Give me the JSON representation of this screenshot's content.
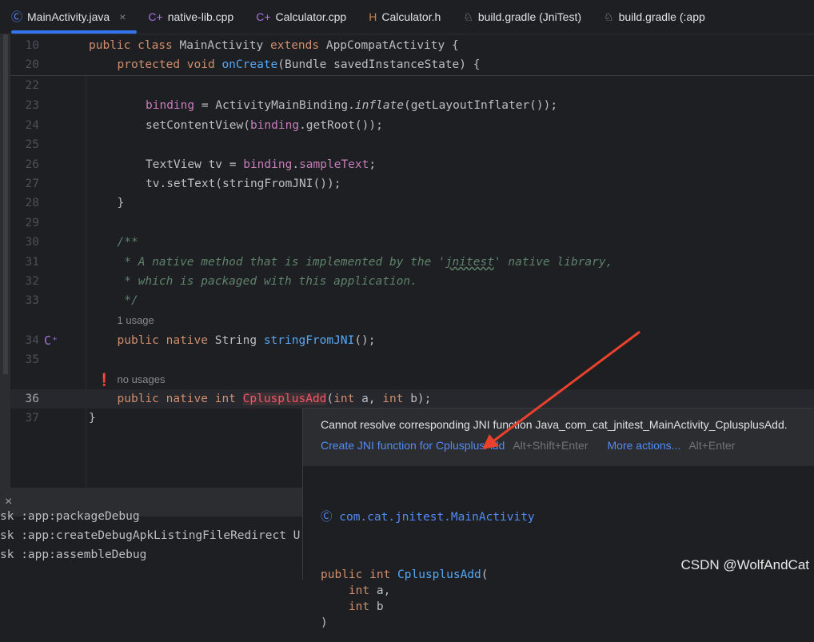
{
  "tabs": [
    {
      "label": "MainActivity.java",
      "icon": "class-icon",
      "glyph": "Ⓒ",
      "color": "#548af7",
      "active": true,
      "close": "×"
    },
    {
      "label": "native-lib.cpp",
      "icon": "cpp-icon",
      "glyph": "C+",
      "color": "#a571e6"
    },
    {
      "label": "Calculator.cpp",
      "icon": "cpp-icon",
      "glyph": "C+",
      "color": "#a571e6"
    },
    {
      "label": "Calculator.h",
      "icon": "header-icon",
      "glyph": "H",
      "color": "#c8834d"
    },
    {
      "label": "build.gradle (JniTest)",
      "icon": "gradle-icon",
      "glyph": "♘",
      "color": "#a8adb5"
    },
    {
      "label": "build.gradle (:app",
      "icon": "gradle-icon",
      "glyph": "♘",
      "color": "#a8adb5"
    }
  ],
  "code_lines": [
    {
      "num": "10",
      "indent": 0,
      "tokens": [
        [
          "public class ",
          "kw"
        ],
        [
          "MainActivity ",
          ""
        ],
        [
          "extends ",
          "kw"
        ],
        [
          "AppCompatActivity {",
          ""
        ]
      ]
    },
    {
      "num": "20",
      "indent": 1,
      "tokens": [
        [
          "protected void ",
          "kw"
        ],
        [
          "onCreate",
          "fn"
        ],
        [
          "(Bundle savedInstanceState) {",
          ""
        ]
      ]
    },
    {
      "num": "22",
      "indent": 0,
      "tokens": []
    },
    {
      "num": "23",
      "indent": 2,
      "tokens": [
        [
          "binding",
          "fld"
        ],
        [
          " = ActivityMainBinding.",
          ""
        ],
        [
          "inflate",
          "it"
        ],
        [
          "(getLayoutInflater());",
          ""
        ]
      ]
    },
    {
      "num": "24",
      "indent": 2,
      "tokens": [
        [
          "setContentView(",
          ""
        ],
        [
          "binding",
          "fld"
        ],
        [
          ".getRoot());",
          ""
        ]
      ]
    },
    {
      "num": "25",
      "indent": 0,
      "tokens": []
    },
    {
      "num": "26",
      "indent": 2,
      "tokens": [
        [
          "TextView tv = ",
          ""
        ],
        [
          "binding",
          "fld"
        ],
        [
          ".",
          ""
        ],
        [
          "sampleText",
          "fld"
        ],
        [
          ";",
          ""
        ]
      ]
    },
    {
      "num": "27",
      "indent": 2,
      "tokens": [
        [
          "tv.setText(stringFromJNI());",
          ""
        ]
      ]
    },
    {
      "num": "28",
      "indent": 1,
      "tokens": [
        [
          "}",
          ""
        ]
      ]
    },
    {
      "num": "29",
      "indent": 0,
      "tokens": []
    },
    {
      "num": "30",
      "indent": 1,
      "tokens": [
        [
          "/**",
          "cm"
        ]
      ]
    },
    {
      "num": "31",
      "indent": 1,
      "tokens": [
        [
          " * A native method that is implemented by the '",
          "cm"
        ],
        [
          "jnitest",
          "cm ul"
        ],
        [
          "' native library,",
          "cm"
        ]
      ]
    },
    {
      "num": "32",
      "indent": 1,
      "tokens": [
        [
          " * which is packaged with this application.",
          "cm"
        ]
      ]
    },
    {
      "num": "33",
      "indent": 1,
      "tokens": [
        [
          " */",
          "cm"
        ]
      ]
    },
    {
      "num": "",
      "indent": 1,
      "hint": "1 usage"
    },
    {
      "num": "34",
      "indent": 1,
      "gutter": "jni-navigate-icon",
      "tokens": [
        [
          "public native ",
          "kw"
        ],
        [
          "String ",
          ""
        ],
        [
          "stringFromJNI",
          "fn"
        ],
        [
          "();",
          ""
        ]
      ]
    },
    {
      "num": "35",
      "indent": 0,
      "tokens": []
    },
    {
      "num": "",
      "indent": 1,
      "hint": "no usages",
      "bulb": true
    },
    {
      "num": "36",
      "indent": 1,
      "current": true,
      "tokens": [
        [
          "public native int ",
          "kw"
        ],
        [
          "CplusplusAdd",
          "err"
        ],
        [
          "(",
          ""
        ],
        [
          "int ",
          "kw"
        ],
        [
          "a, ",
          ""
        ],
        [
          "int ",
          "kw"
        ],
        [
          "b);",
          ""
        ]
      ]
    },
    {
      "num": "37",
      "indent": 0,
      "tokens": [
        [
          "}",
          ""
        ]
      ]
    }
  ],
  "console": {
    "close": "×",
    "lines": [
      "sk :app:packageDebug",
      "sk :app:createDebugApkListingFileRedirect U",
      "sk :app:assembleDebug"
    ]
  },
  "popup": {
    "message": "Cannot resolve corresponding JNI function Java_com_cat_jnitest_MainActivity_CplusplusAdd.",
    "action1": "Create JNI function for CplusplusAdd",
    "action1_key": "Alt+Shift+Enter",
    "action2": "More actions...",
    "action2_key": "Alt+Enter",
    "doc_class": "com.cat.jnitest.MainActivity",
    "doc_sig": [
      [
        "public int ",
        "kw"
      ],
      [
        "CplusplusAdd",
        "fn"
      ],
      [
        "(",
        ""
      ]
    ],
    "doc_params": [
      [
        "    int ",
        "kw",
        "a,"
      ],
      [
        "    int ",
        "kw",
        "b"
      ]
    ],
    "doc_close": ")"
  },
  "annotation": {
    "color": "#e8412c"
  },
  "watermark": "CSDN @WolfAndCat"
}
